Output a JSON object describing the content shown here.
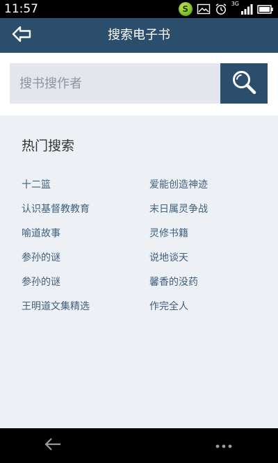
{
  "status_bar": {
    "time": "11:57",
    "app_badge": "S",
    "network_label": "3G",
    "icons": [
      "app-badge-icon",
      "image-notification-icon",
      "alarm-icon",
      "signal-icon",
      "battery-icon"
    ]
  },
  "header": {
    "title": "搜索电子书",
    "back_icon": "back-arrow-icon",
    "background": "#2b4e6d"
  },
  "search": {
    "placeholder": "搜书搜作者",
    "value": "",
    "button_icon": "search-icon"
  },
  "hot": {
    "heading": "热门搜索",
    "left_column": [
      "十二篮",
      "认识基督教教育",
      "喻道故事",
      "参孙的谜",
      "参孙的谜",
      "王明道文集精选"
    ],
    "right_column": [
      "爱能创造神迹",
      "末日属灵争战",
      "灵修书籍",
      "说地谈天",
      "馨香的没药",
      "作完全人"
    ],
    "link_color": "#3f5f7d"
  },
  "nav_bar": {
    "back_icon": "nav-back-icon",
    "menu_icon": "more-dots-icon"
  }
}
